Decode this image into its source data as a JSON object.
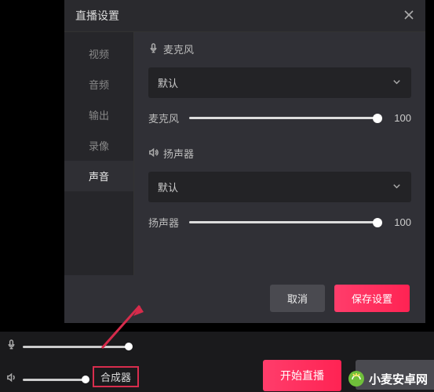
{
  "modal": {
    "title": "直播设置",
    "tabs": [
      "视频",
      "音频",
      "输出",
      "录像",
      "声音"
    ],
    "active_tab_index": 4,
    "mic": {
      "section_label": "麦克风",
      "select_value": "默认",
      "slider_label": "麦克风",
      "slider_value": "100"
    },
    "speaker": {
      "section_label": "扬声器",
      "select_value": "默认",
      "slider_label": "扬声器",
      "slider_value": "100"
    },
    "cancel": "取消",
    "save": "保存设置"
  },
  "bottom": {
    "mixer": "合成器",
    "start": "开始直播"
  },
  "watermark": "小麦安卓网"
}
